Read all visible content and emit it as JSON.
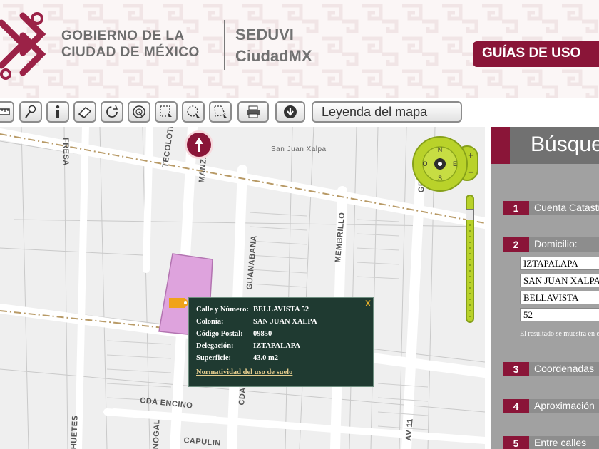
{
  "header": {
    "gov_line1": "GOBIERNO DE LA",
    "gov_line2": "CIUDAD DE MÉXICO",
    "agency_line1": "SEDUVI",
    "agency_line2": "CiudadMX",
    "guides_button": "GUÍAS DE USO"
  },
  "toolbar": {
    "tools": [
      "ruler-icon",
      "pushpin-icon",
      "info-icon",
      "eraser-icon",
      "refresh-icon",
      "radius-icon",
      "select-rectangle-icon",
      "select-circle-icon",
      "select-polygon-icon",
      "print-icon",
      "download-icon"
    ],
    "legend_button": "Leyenda del mapa"
  },
  "map": {
    "streets": {
      "fresa": "FRESA",
      "tecolote": "TECOLOTE",
      "manzana": "MANZANA",
      "san_juan_xalpa": "San Juan Xalpa",
      "guanabana": "GUANABANA",
      "membrillo": "MEMBRILLO",
      "cda_encino": "CDA ENCINO",
      "capulin": "CAPULIN",
      "av11": "AV 11",
      "bellavista": "CDA BELLAVISTA",
      "huetes": "HUETES",
      "nogal": "NOGAL",
      "g_partial": "GR"
    },
    "compass": {
      "n": "N",
      "s": "S",
      "e": "E",
      "o": "O",
      "zoom_in": "+",
      "zoom_out": "−"
    }
  },
  "popup": {
    "close": "X",
    "rows": [
      {
        "label": "Calle y Número:",
        "value": "BELLAVISTA 52"
      },
      {
        "label": "Colonia:",
        "value": "SAN JUAN XALPA"
      },
      {
        "label": "Código Postal:",
        "value": "09850"
      },
      {
        "label": "Delegación:",
        "value": "IZTAPALAPA"
      },
      {
        "label": "Superficie:",
        "value": "43.0 m2"
      }
    ],
    "link": "Normatividad del uso de suelo"
  },
  "panel": {
    "title": "Búsqueda",
    "sections": [
      {
        "num": "1",
        "label": "Cuenta Catastral"
      },
      {
        "num": "2",
        "label": "Domicilio:"
      },
      {
        "num": "3",
        "label": "Coordenadas"
      },
      {
        "num": "4",
        "label": "Aproximación"
      },
      {
        "num": "5",
        "label": "Entre calles"
      }
    ],
    "fields": [
      "IZTAPALAPA",
      "SAN JUAN XALPA",
      "BELLAVISTA",
      "52"
    ],
    "note": "El resultado se muestra en el mapa"
  },
  "colors": {
    "brand": "#8a1538",
    "map_green": "#b9d22a",
    "popup_bg": "#1f3a31",
    "lot_highlight": "#dea3dd"
  }
}
